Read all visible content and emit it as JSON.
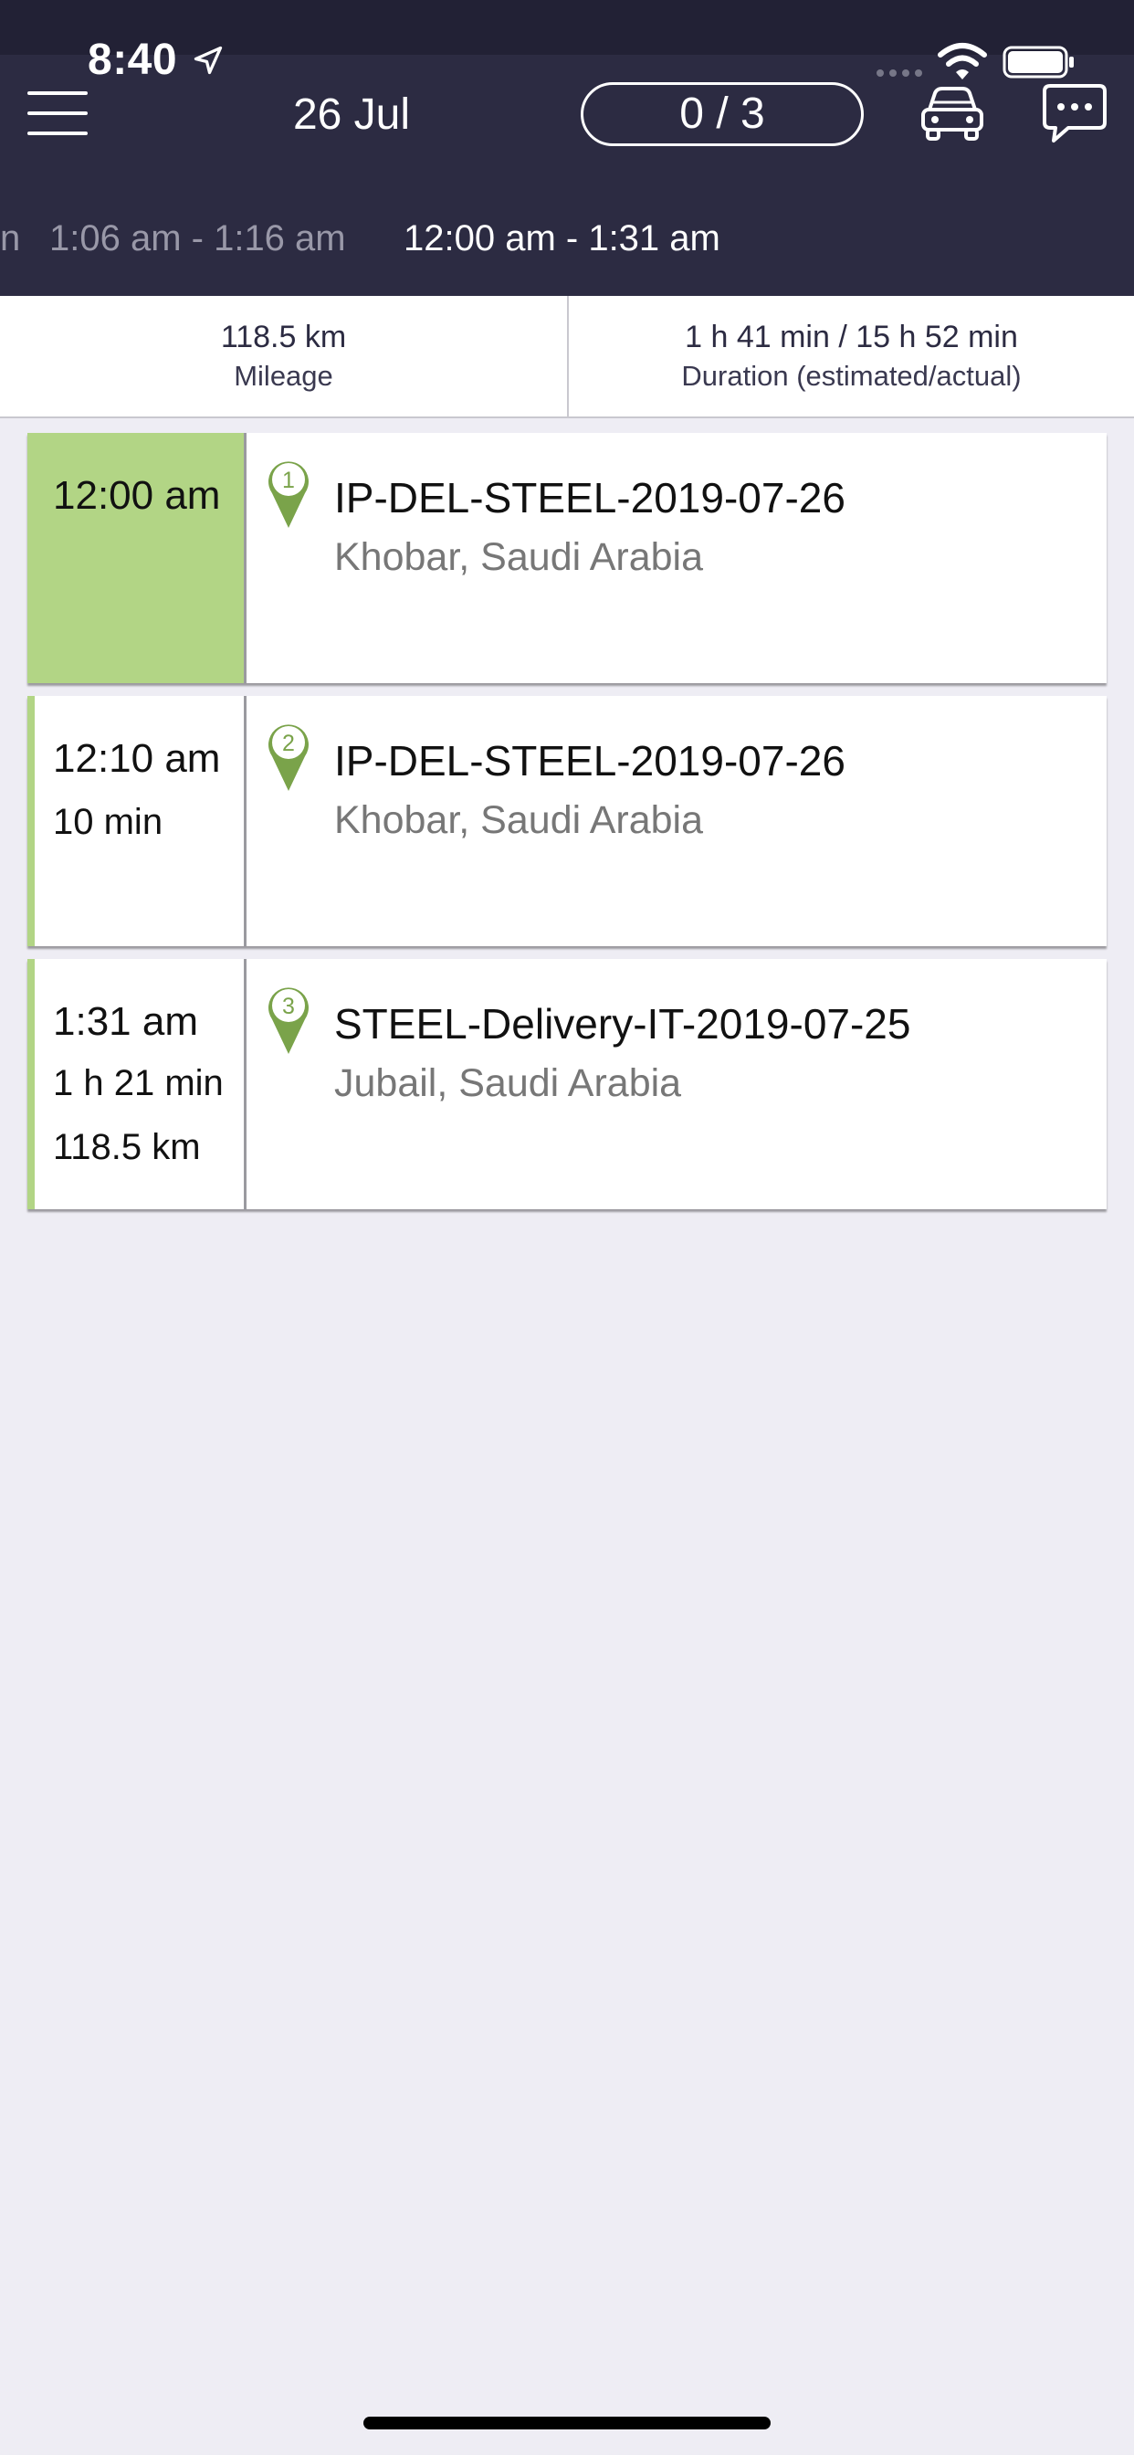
{
  "status_bar": {
    "time": "8:40"
  },
  "header": {
    "date": "26 Jul",
    "progress": "0 / 3"
  },
  "timeslots": [
    {
      "label": "n",
      "state": "inactive"
    },
    {
      "label": "1:06 am - 1:16 am",
      "state": "inactive"
    },
    {
      "label": "12:00 am - 1:31 am",
      "state": "active"
    }
  ],
  "stats": {
    "mileage_value": "118.5 km",
    "mileage_label": "Mileage",
    "duration_value": "1 h 41 min / 15 h 52 min",
    "duration_label": "Duration (estimated/actual)"
  },
  "stops": [
    {
      "number": "1",
      "time": "12:00 am",
      "details": [],
      "name": "IP-DEL-STEEL-2019-07-26",
      "address": "Khobar, Saudi Arabia",
      "completed": true
    },
    {
      "number": "2",
      "time": "12:10 am",
      "details": [
        "10 min"
      ],
      "name": "IP-DEL-STEEL-2019-07-26",
      "address": "Khobar, Saudi Arabia",
      "completed": false
    },
    {
      "number": "3",
      "time": "1:31 am",
      "details": [
        "1 h 21 min",
        "118.5 km"
      ],
      "name": "STEEL-Delivery-IT-2019-07-25",
      "address": "Jubail, Saudi Arabia",
      "completed": false
    }
  ],
  "colors": {
    "header_bg": "#2c2b42",
    "accent_green": "#b2d585",
    "pin_green": "#7aa34a",
    "timeslot_inactive": "#9998a8",
    "timeslot_active": "#ffffff",
    "page_bg": "#eeedf4"
  }
}
